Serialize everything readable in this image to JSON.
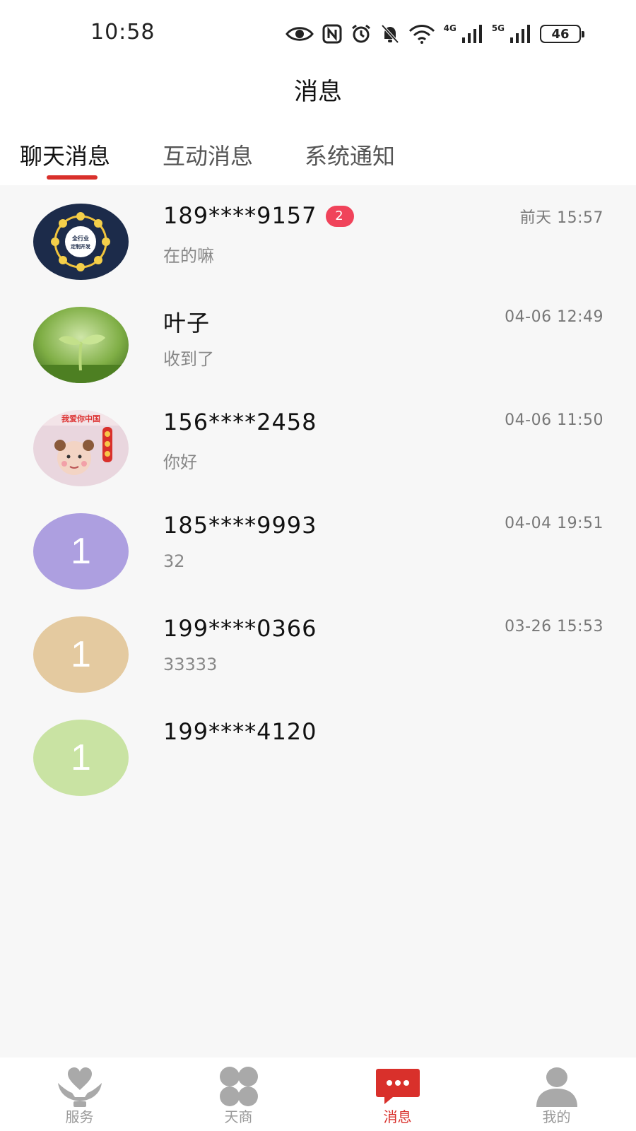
{
  "status_bar": {
    "time": "10:58",
    "signal_1_label": "4G",
    "signal_2_label": "5G",
    "battery": "46"
  },
  "header": {
    "title": "消息"
  },
  "tabs": [
    {
      "label": "聊天消息",
      "active": true
    },
    {
      "label": "互动消息",
      "active": false
    },
    {
      "label": "系统通知",
      "active": false
    }
  ],
  "conversations": [
    {
      "name": "189****9157",
      "badge": "2",
      "preview": "在的嘛",
      "time": "前天 15:57",
      "avatar": "image-service-circle",
      "avatar_text": "全行业\n定制开发"
    },
    {
      "name": "叶子",
      "badge": "",
      "preview": "收到了",
      "time": "04-06 12:49",
      "avatar": "image-sprout"
    },
    {
      "name": "156****2458",
      "badge": "",
      "preview": "你好",
      "time": "04-06 11:50",
      "avatar": "image-child-photo",
      "avatar_text": "我爱你中国"
    },
    {
      "name": "185****9993",
      "badge": "",
      "preview": "32",
      "time": "04-04 19:51",
      "avatar": "initial",
      "initial": "1",
      "avatar_color": "#ad9fe0"
    },
    {
      "name": "199****0366",
      "badge": "",
      "preview": "33333",
      "time": "03-26 15:53",
      "avatar": "initial",
      "initial": "1",
      "avatar_color": "#e4caa0"
    },
    {
      "name": "199****4120",
      "badge": "",
      "preview": "",
      "time": "",
      "avatar": "initial",
      "initial": "1",
      "avatar_color": "#c9e3a3"
    }
  ],
  "bottom_nav": [
    {
      "label": "服务",
      "icon": "heart-hands-icon",
      "active": false
    },
    {
      "label": "天商",
      "icon": "clover-icon",
      "active": false
    },
    {
      "label": "消息",
      "icon": "chat-bubble-icon",
      "active": true
    },
    {
      "label": "我的",
      "icon": "person-icon",
      "active": false
    }
  ],
  "colors": {
    "accent": "#d9302b",
    "badge": "#f0435a",
    "inactive_icon": "#a9a9a9"
  }
}
